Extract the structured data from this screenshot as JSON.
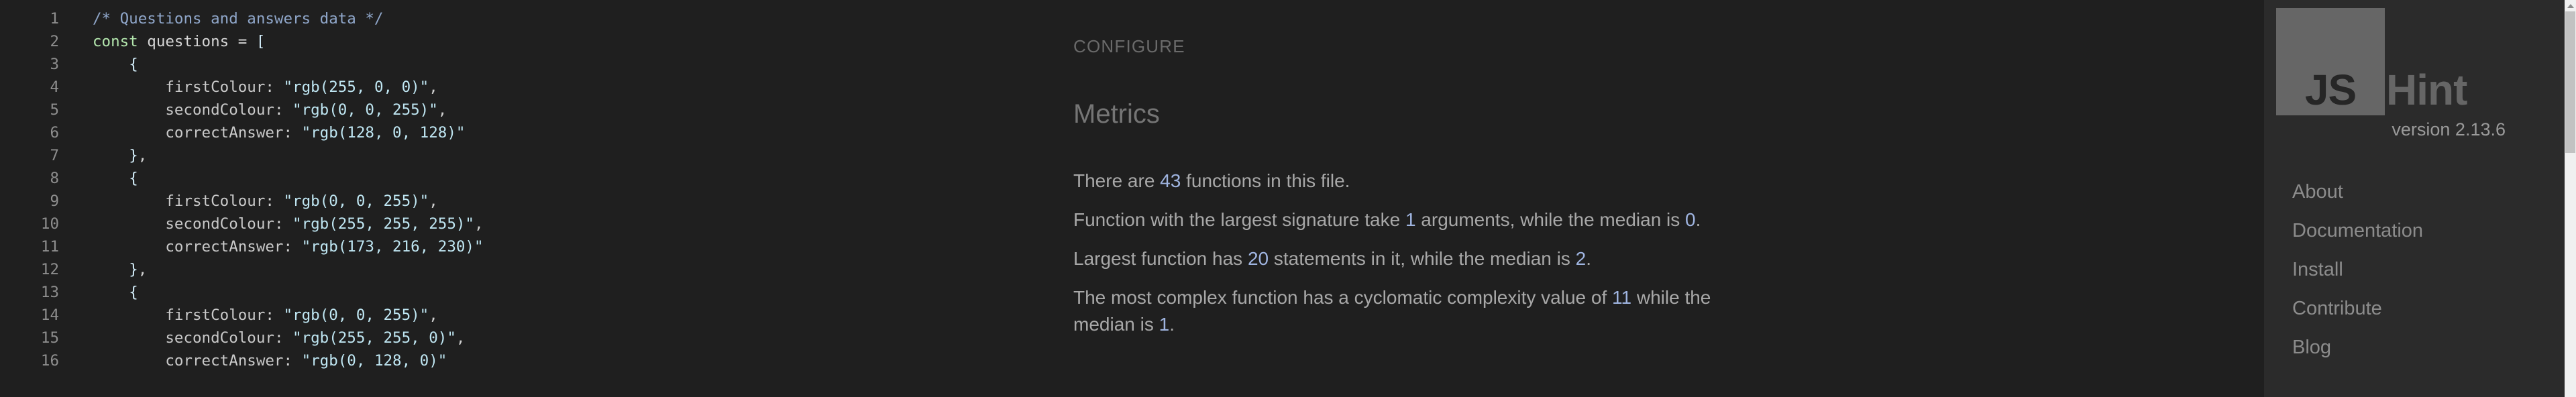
{
  "editor": {
    "language": "javascript",
    "lines": [
      {
        "n": "1",
        "tokens": [
          {
            "t": "com",
            "v": "/* Questions and answers data */"
          }
        ]
      },
      {
        "n": "2",
        "tokens": [
          {
            "t": "kw",
            "v": "const"
          },
          {
            "t": "var",
            "v": " questions "
          },
          {
            "t": "op",
            "v": "= "
          },
          {
            "t": "brk",
            "v": "["
          }
        ]
      },
      {
        "n": "3",
        "tokens": [
          {
            "t": "plain",
            "v": "    "
          },
          {
            "t": "brk",
            "v": "{"
          }
        ]
      },
      {
        "n": "4",
        "tokens": [
          {
            "t": "plain",
            "v": "        "
          },
          {
            "t": "prop",
            "v": "firstColour"
          },
          {
            "t": "punc",
            "v": ": "
          },
          {
            "t": "str",
            "v": "\"rgb(255, 0, 0)\""
          },
          {
            "t": "punc",
            "v": ","
          }
        ]
      },
      {
        "n": "5",
        "tokens": [
          {
            "t": "plain",
            "v": "        "
          },
          {
            "t": "prop",
            "v": "secondColour"
          },
          {
            "t": "punc",
            "v": ": "
          },
          {
            "t": "str",
            "v": "\"rgb(0, 0, 255)\""
          },
          {
            "t": "punc",
            "v": ","
          }
        ]
      },
      {
        "n": "6",
        "tokens": [
          {
            "t": "plain",
            "v": "        "
          },
          {
            "t": "prop",
            "v": "correctAnswer"
          },
          {
            "t": "punc",
            "v": ": "
          },
          {
            "t": "str",
            "v": "\"rgb(128, 0, 128)\""
          }
        ]
      },
      {
        "n": "7",
        "tokens": [
          {
            "t": "plain",
            "v": "    "
          },
          {
            "t": "brk",
            "v": "}"
          },
          {
            "t": "punc",
            "v": ","
          }
        ]
      },
      {
        "n": "8",
        "tokens": [
          {
            "t": "plain",
            "v": "    "
          },
          {
            "t": "brk",
            "v": "{"
          }
        ]
      },
      {
        "n": "9",
        "tokens": [
          {
            "t": "plain",
            "v": "        "
          },
          {
            "t": "prop",
            "v": "firstColour"
          },
          {
            "t": "punc",
            "v": ": "
          },
          {
            "t": "str",
            "v": "\"rgb(0, 0, 255)\""
          },
          {
            "t": "punc",
            "v": ","
          }
        ]
      },
      {
        "n": "10",
        "tokens": [
          {
            "t": "plain",
            "v": "        "
          },
          {
            "t": "prop",
            "v": "secondColour"
          },
          {
            "t": "punc",
            "v": ": "
          },
          {
            "t": "str",
            "v": "\"rgb(255, 255, 255)\""
          },
          {
            "t": "punc",
            "v": ","
          }
        ]
      },
      {
        "n": "11",
        "tokens": [
          {
            "t": "plain",
            "v": "        "
          },
          {
            "t": "prop",
            "v": "correctAnswer"
          },
          {
            "t": "punc",
            "v": ": "
          },
          {
            "t": "str",
            "v": "\"rgb(173, 216, 230)\""
          }
        ]
      },
      {
        "n": "12",
        "tokens": [
          {
            "t": "plain",
            "v": "    "
          },
          {
            "t": "brk",
            "v": "}"
          },
          {
            "t": "punc",
            "v": ","
          }
        ]
      },
      {
        "n": "13",
        "tokens": [
          {
            "t": "plain",
            "v": "    "
          },
          {
            "t": "brk",
            "v": "{"
          }
        ]
      },
      {
        "n": "14",
        "tokens": [
          {
            "t": "plain",
            "v": "        "
          },
          {
            "t": "prop",
            "v": "firstColour"
          },
          {
            "t": "punc",
            "v": ": "
          },
          {
            "t": "str",
            "v": "\"rgb(0, 0, 255)\""
          },
          {
            "t": "punc",
            "v": ","
          }
        ]
      },
      {
        "n": "15",
        "tokens": [
          {
            "t": "plain",
            "v": "        "
          },
          {
            "t": "prop",
            "v": "secondColour"
          },
          {
            "t": "punc",
            "v": ": "
          },
          {
            "t": "str",
            "v": "\"rgb(255, 255, 0)\""
          },
          {
            "t": "punc",
            "v": ","
          }
        ]
      },
      {
        "n": "16",
        "tokens": [
          {
            "t": "plain",
            "v": "        "
          },
          {
            "t": "prop",
            "v": "correctAnswer"
          },
          {
            "t": "punc",
            "v": ": "
          },
          {
            "t": "str",
            "v": "\"rgb(0, 128, 0)\""
          }
        ]
      }
    ]
  },
  "info": {
    "configure_label": "CONFIGURE",
    "metrics_heading": "Metrics",
    "metrics": [
      {
        "parts": [
          {
            "t": "text",
            "v": "There are "
          },
          {
            "t": "num",
            "v": "43"
          },
          {
            "t": "text",
            "v": " functions in this file."
          }
        ]
      },
      {
        "parts": [
          {
            "t": "text",
            "v": "Function with the largest signature take "
          },
          {
            "t": "num",
            "v": "1"
          },
          {
            "t": "text",
            "v": " arguments, while the median is "
          },
          {
            "t": "num",
            "v": "0"
          },
          {
            "t": "text",
            "v": "."
          }
        ]
      },
      {
        "parts": [
          {
            "t": "text",
            "v": "Largest function has "
          },
          {
            "t": "num",
            "v": "20"
          },
          {
            "t": "text",
            "v": " statements in it, while the median is "
          },
          {
            "t": "num",
            "v": "2"
          },
          {
            "t": "text",
            "v": "."
          }
        ]
      },
      {
        "parts": [
          {
            "t": "text",
            "v": "The most complex function has a cyclomatic complexity value of "
          },
          {
            "t": "num",
            "v": "11"
          },
          {
            "t": "text",
            "v": " while the median is "
          },
          {
            "t": "num",
            "v": "1"
          },
          {
            "t": "text",
            "v": "."
          }
        ]
      }
    ]
  },
  "sidebar": {
    "logo_js": "JS",
    "logo_hint": "Hint",
    "version": "version 2.13.6",
    "nav_items": [
      {
        "label": "About"
      },
      {
        "label": "Documentation"
      },
      {
        "label": "Install"
      },
      {
        "label": "Contribute"
      },
      {
        "label": "Blog"
      }
    ]
  },
  "scrollbar": {
    "up_arrow_icon": "chevron-up-icon"
  },
  "colors": {
    "background": "#1f1f1f",
    "sidebar_background": "#2b2b2b",
    "logo_gray": "#666666",
    "metric_number": "#9fb4e0",
    "comment": "#8fa6c9",
    "keyword": "#b3e6ad",
    "string": "#bfe6f2"
  }
}
